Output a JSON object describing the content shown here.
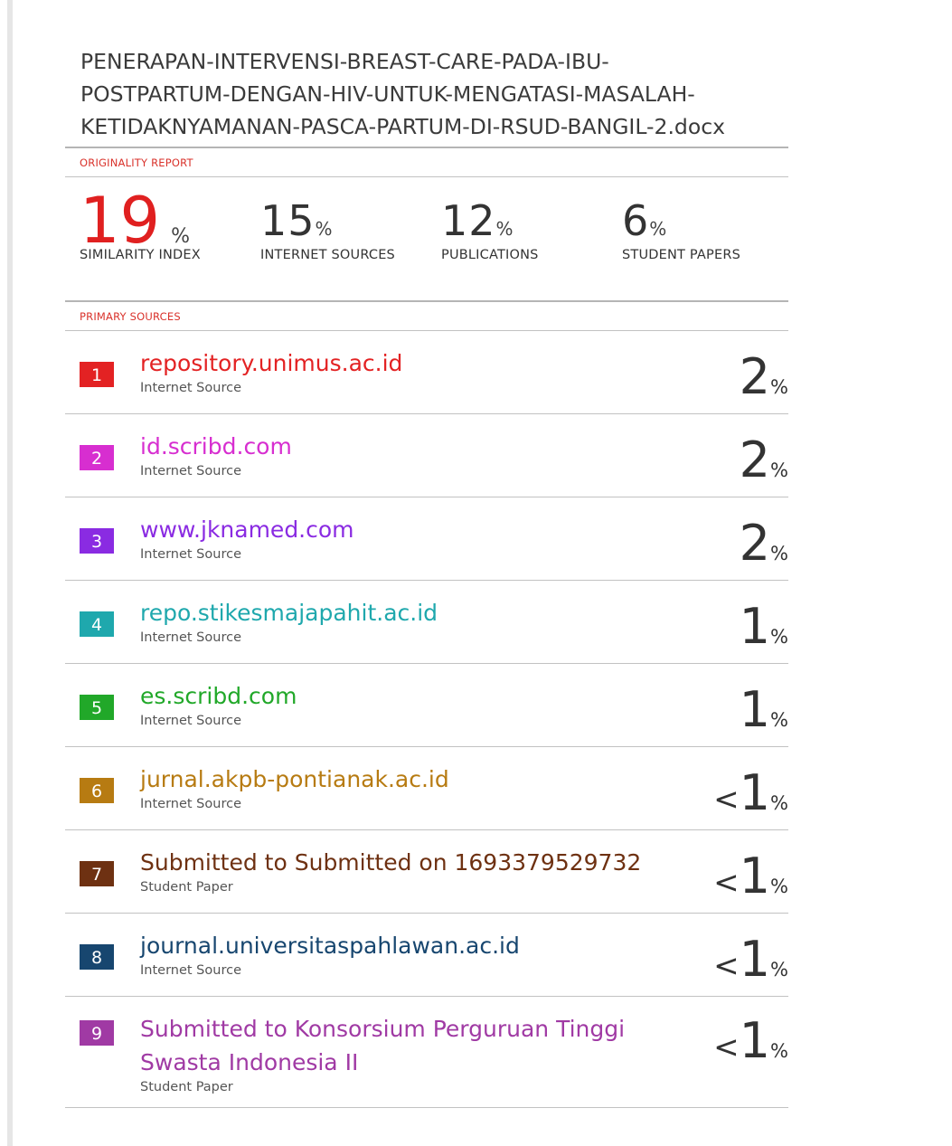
{
  "document": {
    "title_lines": [
      "PENERAPAN-INTERVENSI-BREAST-CARE-PADA-IBU-",
      "POSTPARTUM-DENGAN-HIV-UNTUK-MENGATASI-MASALAH-",
      "KETIDAKNYAMANAN-PASCA-PARTUM-DI-RSUD-BANGIL-2.docx"
    ]
  },
  "originality_report": {
    "label": "ORIGINALITY REPORT",
    "percent_sign": "%",
    "similarity_index": {
      "value": "19",
      "label": "SIMILARITY INDEX"
    },
    "internet_sources": {
      "value": "15",
      "label": "INTERNET SOURCES"
    },
    "publications": {
      "value": "12",
      "label": "PUBLICATIONS"
    },
    "student_papers": {
      "value": "6",
      "label": "STUDENT PAPERS"
    }
  },
  "primary_sources": {
    "label": "PRIMARY SOURCES",
    "items": [
      {
        "rank": "1",
        "name_lines": [
          "repository.unimus.ac.id"
        ],
        "type": "Internet Source",
        "prefix": "",
        "value": "2",
        "pct": "%",
        "color": "#e32223"
      },
      {
        "rank": "2",
        "name_lines": [
          "id.scribd.com"
        ],
        "type": "Internet Source",
        "prefix": "",
        "value": "2",
        "pct": "%",
        "color": "#d72ed0"
      },
      {
        "rank": "3",
        "name_lines": [
          "www.jknamed.com"
        ],
        "type": "Internet Source",
        "prefix": "",
        "value": "2",
        "pct": "%",
        "color": "#8a2be2"
      },
      {
        "rank": "4",
        "name_lines": [
          "repo.stikesmajapahit.ac.id"
        ],
        "type": "Internet Source",
        "prefix": "",
        "value": "1",
        "pct": "%",
        "color": "#1fa8ad"
      },
      {
        "rank": "5",
        "name_lines": [
          "es.scribd.com"
        ],
        "type": "Internet Source",
        "prefix": "",
        "value": "1",
        "pct": "%",
        "color": "#21a829"
      },
      {
        "rank": "6",
        "name_lines": [
          "jurnal.akpb-pontianak.ac.id"
        ],
        "type": "Internet Source",
        "prefix": "<",
        "value": "1",
        "pct": "%",
        "color": "#b77b12"
      },
      {
        "rank": "7",
        "name_lines": [
          "Submitted to Submitted on 1693379529732"
        ],
        "type": "Student Paper",
        "prefix": "<",
        "value": "1",
        "pct": "%",
        "color": "#6e3112"
      },
      {
        "rank": "8",
        "name_lines": [
          "journal.universitaspahlawan.ac.id"
        ],
        "type": "Internet Source",
        "prefix": "<",
        "value": "1",
        "pct": "%",
        "color": "#17466f"
      },
      {
        "rank": "9",
        "name_lines": [
          "Submitted to Konsorsium Perguruan Tinggi",
          "Swasta Indonesia II"
        ],
        "type": "Student Paper",
        "prefix": "<",
        "value": "1",
        "pct": "%",
        "color": "#a03aa4"
      }
    ]
  }
}
